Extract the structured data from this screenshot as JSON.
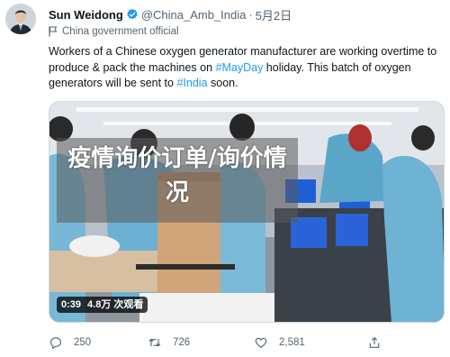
{
  "author": {
    "display_name": "Sun Weidong",
    "handle": "@China_Amb_India",
    "separator": "·",
    "date": "5月2日",
    "label": "China government official"
  },
  "tweet": {
    "text_part1": "Workers of a Chinese oxygen generator manufacturer are working overtime to produce & pack the machines on ",
    "hashtag1": "#MayDay",
    "text_part2": " holiday. This batch of oxygen generators will be sent to ",
    "hashtag2": "#India",
    "text_part3": " soon."
  },
  "media": {
    "overlay_text": "疫情询价订单/询价情况",
    "duration": "0:39",
    "views": "4.8万 次观看"
  },
  "actions": {
    "replies": "250",
    "retweets": "726",
    "likes": "2,581"
  },
  "colors": {
    "link": "#1d9bf0",
    "secondary_text": "#536471",
    "verified_badge": "#1d9bf0"
  },
  "icons": [
    "verified-icon",
    "flag-icon",
    "reply-icon",
    "retweet-icon",
    "like-icon",
    "share-icon"
  ]
}
